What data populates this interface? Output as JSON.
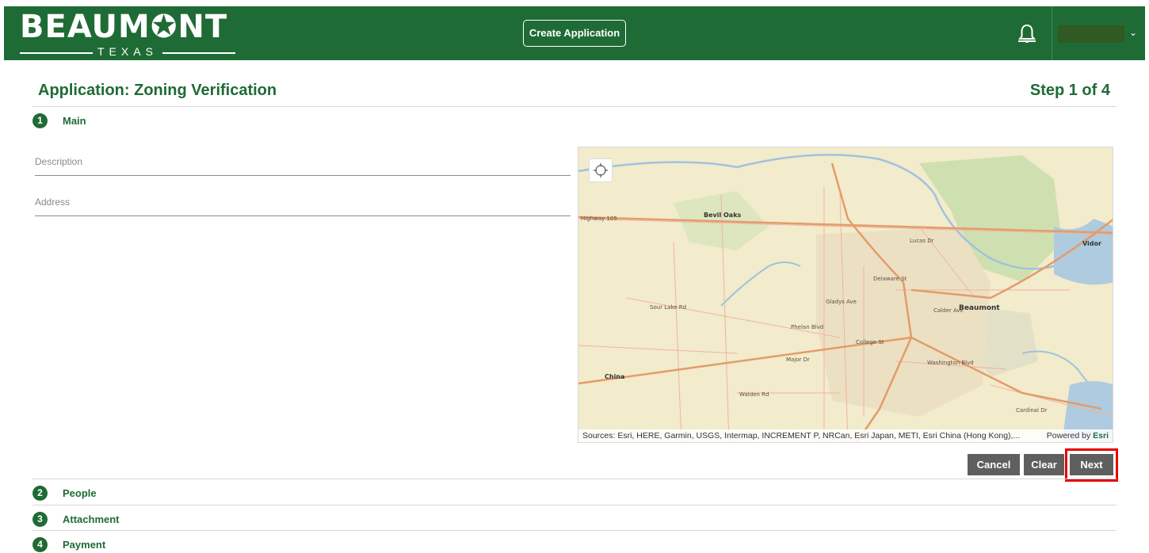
{
  "header": {
    "logo_main": "BEAUM✪NT",
    "logo_sub": "TEXAS",
    "create_label": "Create Application"
  },
  "page": {
    "title": "Application: Zoning Verification",
    "step": "Step 1 of 4"
  },
  "sections": [
    {
      "number": "1",
      "label": "Main"
    },
    {
      "number": "2",
      "label": "People"
    },
    {
      "number": "3",
      "label": "Attachment"
    },
    {
      "number": "4",
      "label": "Payment"
    }
  ],
  "form": {
    "description_label": "Description",
    "address_label": "Address"
  },
  "map": {
    "labels": [
      "Bevil Oaks",
      "Beaumont",
      "China",
      "Vidor",
      "Highway 105",
      "Sour Lake Rd",
      "Gladys Ave",
      "Phelan Blvd",
      "College St",
      "Washington Blvd",
      "Walden Rd",
      "Lucas Dr",
      "Calder Ave",
      "Delaware St",
      "Cardinal Dr",
      "Major Dr"
    ],
    "attribution": "Sources: Esri, HERE, Garmin, USGS, Intermap, INCREMENT P, NRCan, Esri Japan, METI, Esri China (Hong Kong),...",
    "powered_prefix": "Powered by ",
    "powered_brand": "Esri"
  },
  "actions": {
    "cancel_label": "Cancel",
    "clear_label": "Clear",
    "next_label": "Next"
  },
  "colors": {
    "brand_green": "#1f6b35",
    "button_gray": "#5f5f5f",
    "highlight_red": "#e60000"
  }
}
